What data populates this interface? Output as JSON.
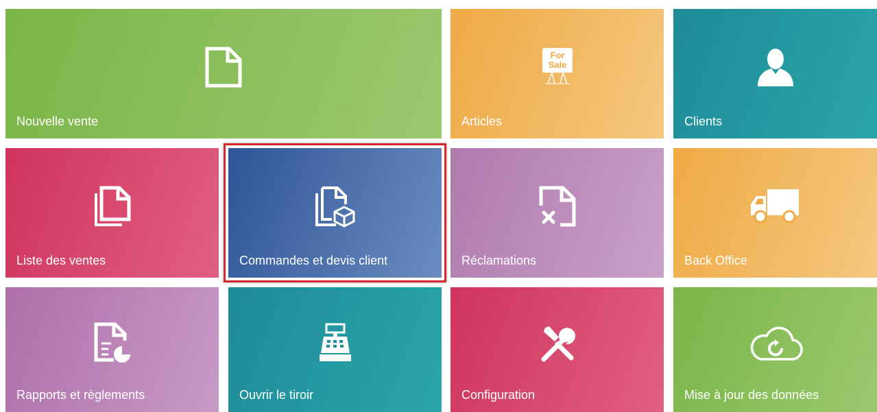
{
  "tiles": [
    {
      "label": "Nouvelle vente",
      "icon": "new-document-icon",
      "color": "#7ab648"
    },
    {
      "label": "Articles",
      "icon": "for-sale-sign-icon",
      "color": "#efaa44"
    },
    {
      "label": "Clients",
      "icon": "person-icon",
      "color": "#1e8c99"
    },
    {
      "label": "Liste des ventes",
      "icon": "documents-stack-icon",
      "color": "#d0345e"
    },
    {
      "label": "Commandes et devis client",
      "icon": "documents-box-icon",
      "color": "#2f5597",
      "selected": true
    },
    {
      "label": "Réclamations",
      "icon": "document-cross-icon",
      "color": "#b07aae"
    },
    {
      "label": "Back Office",
      "icon": "truck-icon",
      "color": "#efaa44"
    },
    {
      "label": "Rapports et règlements",
      "icon": "report-chart-icon",
      "color": "#ae6fa9"
    },
    {
      "label": "Ouvrir le tiroir",
      "icon": "cash-register-icon",
      "color": "#1e8c99"
    },
    {
      "label": "Configuration",
      "icon": "tools-icon",
      "color": "#d0345e"
    },
    {
      "label": "Mise à jour des données",
      "icon": "cloud-refresh-icon",
      "color": "#7ab648"
    }
  ],
  "sign_text": {
    "line1": "For",
    "line2": "Sale"
  },
  "selection_color": "#d8262d"
}
